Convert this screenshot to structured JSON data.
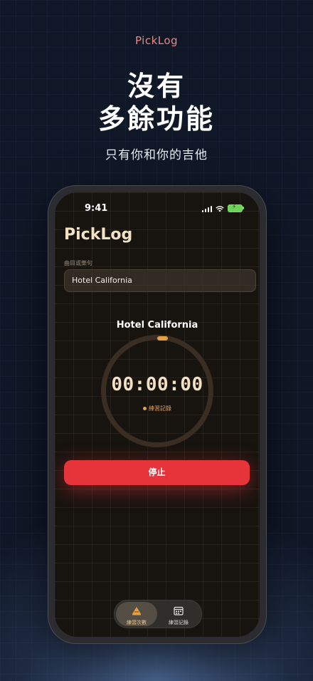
{
  "promo": {
    "brand": "PickLog",
    "headline_line1": "沒有",
    "headline_line2": "多餘功能",
    "subhead": "只有你和你的吉他"
  },
  "status_bar": {
    "time": "9:41"
  },
  "app": {
    "title": "PickLog",
    "search": {
      "label": "曲目或樂句",
      "value": "Hotel California"
    },
    "current_song": "Hotel California",
    "timer": "00:00:00",
    "record_indicator": "練習記錄",
    "stop_button": "停止"
  },
  "tab_bar": {
    "tabs": [
      {
        "label": "練習次數",
        "icon": "guitar-pick-icon",
        "active": true
      },
      {
        "label": "練習記錄",
        "icon": "calendar-icon",
        "active": false
      }
    ]
  },
  "colors": {
    "accent": "#e7a04c",
    "stop": "#e6343a",
    "brand": "#e58a86"
  }
}
